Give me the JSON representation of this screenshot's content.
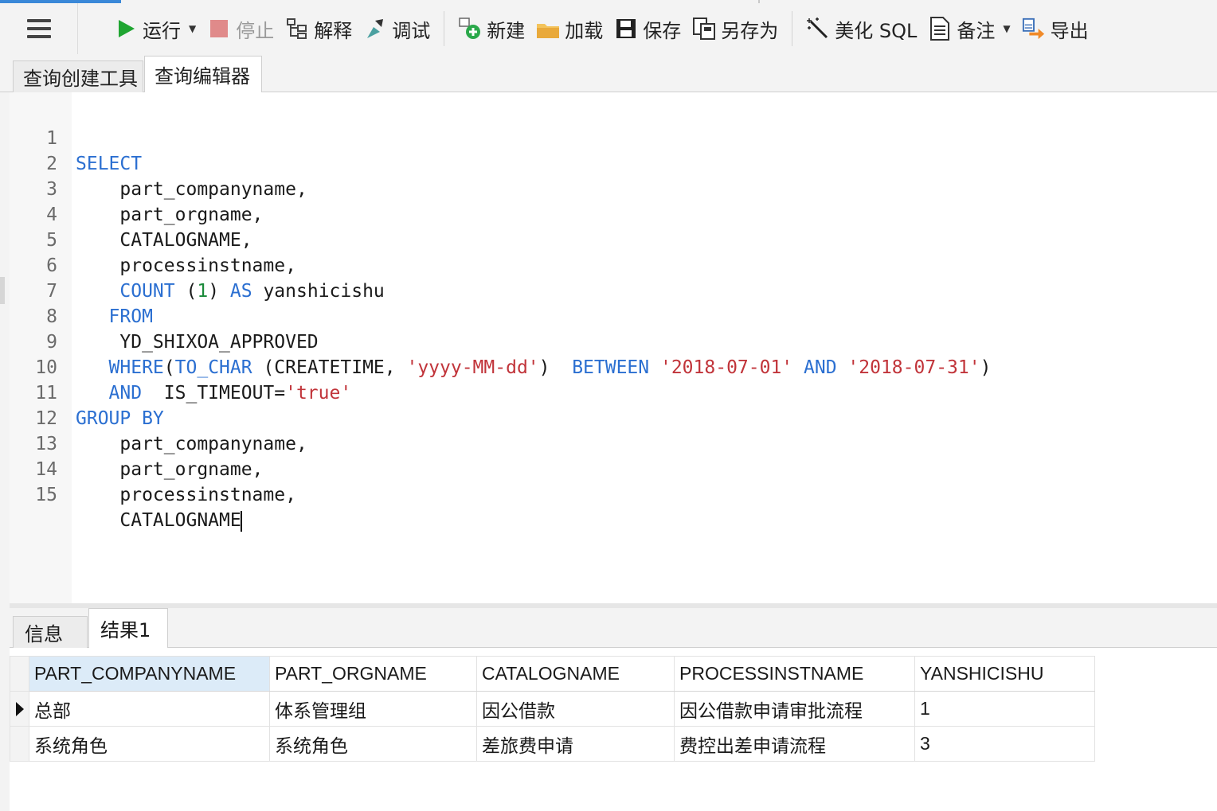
{
  "toolbar": {
    "menu_icon": "hamburger-menu-icon",
    "run": "运行",
    "stop": "停止",
    "explain": "解释",
    "debug": "调试",
    "new": "新建",
    "load": "加载",
    "save": "保存",
    "save_as": "另存为",
    "beautify": "美化 SQL",
    "comment": "备注",
    "export": "导出"
  },
  "query_tabs": [
    "查询创建工具",
    "查询编辑器"
  ],
  "editor": {
    "lines": [
      {
        "n": "1"
      },
      {
        "n": "2"
      },
      {
        "n": "3"
      },
      {
        "n": "4"
      },
      {
        "n": "5"
      },
      {
        "n": "6"
      },
      {
        "n": "7"
      },
      {
        "n": "8"
      },
      {
        "n": "9"
      },
      {
        "n": "10"
      },
      {
        "n": "11"
      },
      {
        "n": "12"
      },
      {
        "n": "13"
      },
      {
        "n": "14"
      },
      {
        "n": "15"
      }
    ],
    "sql": {
      "l1": {
        "kw": "SELECT"
      },
      "l2": {
        "text": "    part_companyname,"
      },
      "l3": {
        "text": "    part_orgname,"
      },
      "l4": {
        "text": "    CATALOGNAME,"
      },
      "l5": {
        "text": "    processinstname,"
      },
      "l6": {
        "indent": "    ",
        "kw1": "COUNT",
        "p1": " (",
        "num": "1",
        "p2": ") ",
        "kw2": "AS",
        "rest": " yanshicishu"
      },
      "l7": {
        "indent": "   ",
        "kw": "FROM"
      },
      "l8": {
        "text": "    YD_SHIXOA_APPROVED"
      },
      "l9": {
        "indent": "   ",
        "kw1": "WHERE",
        "p1": "(",
        "kw2": "TO_CHAR",
        "p2": " (CREATETIME, ",
        "s1": "'yyyy-MM-dd'",
        "p3": ")  ",
        "kw3": "BETWEEN",
        "p4": " ",
        "s2": "'2018-07-01'",
        "p5": " ",
        "kw4": "AND",
        "p6": " ",
        "s3": "'2018-07-31'",
        "p7": ")"
      },
      "l10": {
        "indent": "   ",
        "kw": "AND",
        "p1": "  IS_TIMEOUT=",
        "s1": "'true'"
      },
      "l11": {
        "kw": "GROUP BY"
      },
      "l12": {
        "text": "    part_companyname,"
      },
      "l13": {
        "text": "    part_orgname,"
      },
      "l14": {
        "text": "    processinstname,"
      },
      "l15": {
        "text": "    CATALOGNAME"
      }
    }
  },
  "result_tabs": [
    "信息",
    "结果1"
  ],
  "grid": {
    "columns": [
      "PART_COMPANYNAME",
      "PART_ORGNAME",
      "CATALOGNAME",
      "PROCESSINSTNAME",
      "YANSHICISHU"
    ],
    "rows": [
      [
        "总部",
        "体系管理组",
        "因公借款",
        "因公借款申请审批流程",
        "1"
      ],
      [
        "系统角色",
        "系统角色",
        "差旅费申请",
        "费控出差申请流程",
        "3"
      ]
    ]
  },
  "colors": {
    "keyword": "#2b6fd1",
    "string": "#c1343a",
    "number": "#1a8a3a",
    "run_icon": "#1fa531",
    "stop_icon": "#e08a8a"
  }
}
